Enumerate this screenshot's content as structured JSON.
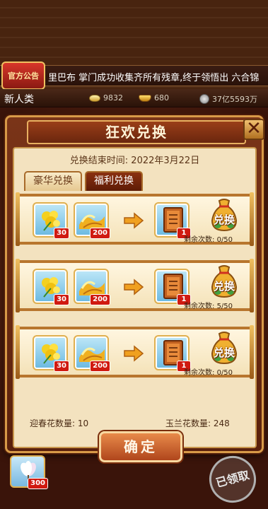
{
  "ticker": {
    "badge": "官方公告",
    "text": "里巴布 掌门成功收集齐所有残章,终于领悟出 六合锦"
  },
  "resources": {
    "category": "新人类",
    "silver": "9832",
    "gold": "680",
    "copper": "37亿5593万"
  },
  "dialog": {
    "title": "狂欢兑换",
    "close": "✕",
    "end_time": "兑换结束时间: 2022年3月22日",
    "tabs": [
      "豪华兑换",
      "福利兑换"
    ],
    "rows": [
      {
        "in1_count": "30",
        "in2_count": "200",
        "out_count": "1",
        "exchange_label": "兑换",
        "remain_label": "剩余次数:",
        "remain_value": "0/50"
      },
      {
        "in1_count": "30",
        "in2_count": "200",
        "out_count": "1",
        "exchange_label": "兑换",
        "remain_label": "剩余次数:",
        "remain_value": "5/50"
      },
      {
        "in1_count": "30",
        "in2_count": "200",
        "out_count": "1",
        "exchange_label": "兑换",
        "remain_label": "剩余次数:",
        "remain_value": "0/50"
      }
    ],
    "winter_jasmine_count": "迎春花数量: 10",
    "magnolia_count": "玉兰花数量: 248",
    "confirm": "确定"
  },
  "bottom": {
    "item_count": "300",
    "stamp": "已领取"
  },
  "colors": {
    "panel_border": "#d89a48",
    "count_badge": "#d01a10",
    "parchment": "#f3e2bf"
  }
}
